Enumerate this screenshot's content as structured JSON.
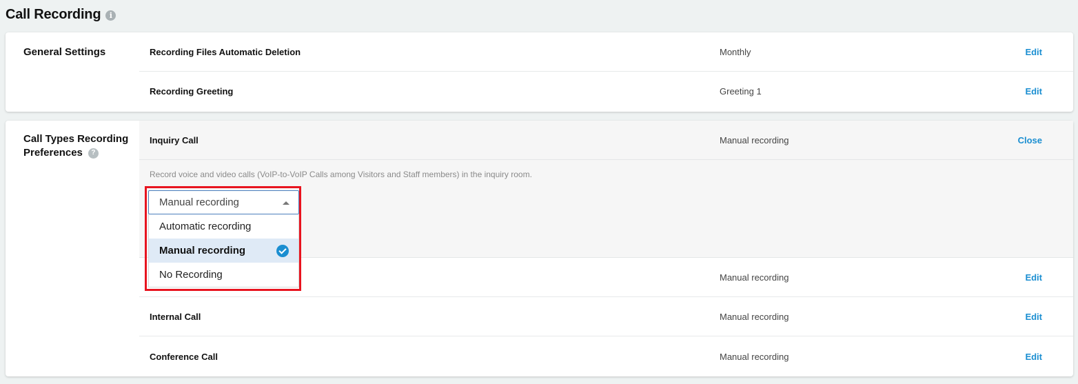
{
  "page": {
    "title": "Call Recording",
    "info_icon": "i"
  },
  "general": {
    "title": "General Settings",
    "rows": [
      {
        "name": "Recording Files Automatic Deletion",
        "value": "Monthly",
        "action": "Edit"
      },
      {
        "name": "Recording Greeting",
        "value": "Greeting 1",
        "action": "Edit"
      }
    ]
  },
  "call_types": {
    "title_line1": "Call Types Recording",
    "title_line2": "Preferences",
    "help_icon": "?",
    "expanded": {
      "name": "Inquiry Call",
      "value": "Manual recording",
      "action": "Close",
      "description": "Record voice and video calls (VoIP-to-VoIP Calls among Visitors and Staff members) in the inquiry room.",
      "select": {
        "selected": "Manual recording",
        "options": [
          "Automatic recording",
          "Manual recording",
          "No Recording"
        ]
      }
    },
    "rows": [
      {
        "name": "",
        "value": "Manual recording",
        "action": "Edit"
      },
      {
        "name": "Internal Call",
        "value": "Manual recording",
        "action": "Edit"
      },
      {
        "name": "Conference Call",
        "value": "Manual recording",
        "action": "Edit"
      }
    ]
  },
  "colors": {
    "accent": "#1a8ed1",
    "highlight": "#e8141f",
    "selected_bg": "#dfeaf6"
  }
}
